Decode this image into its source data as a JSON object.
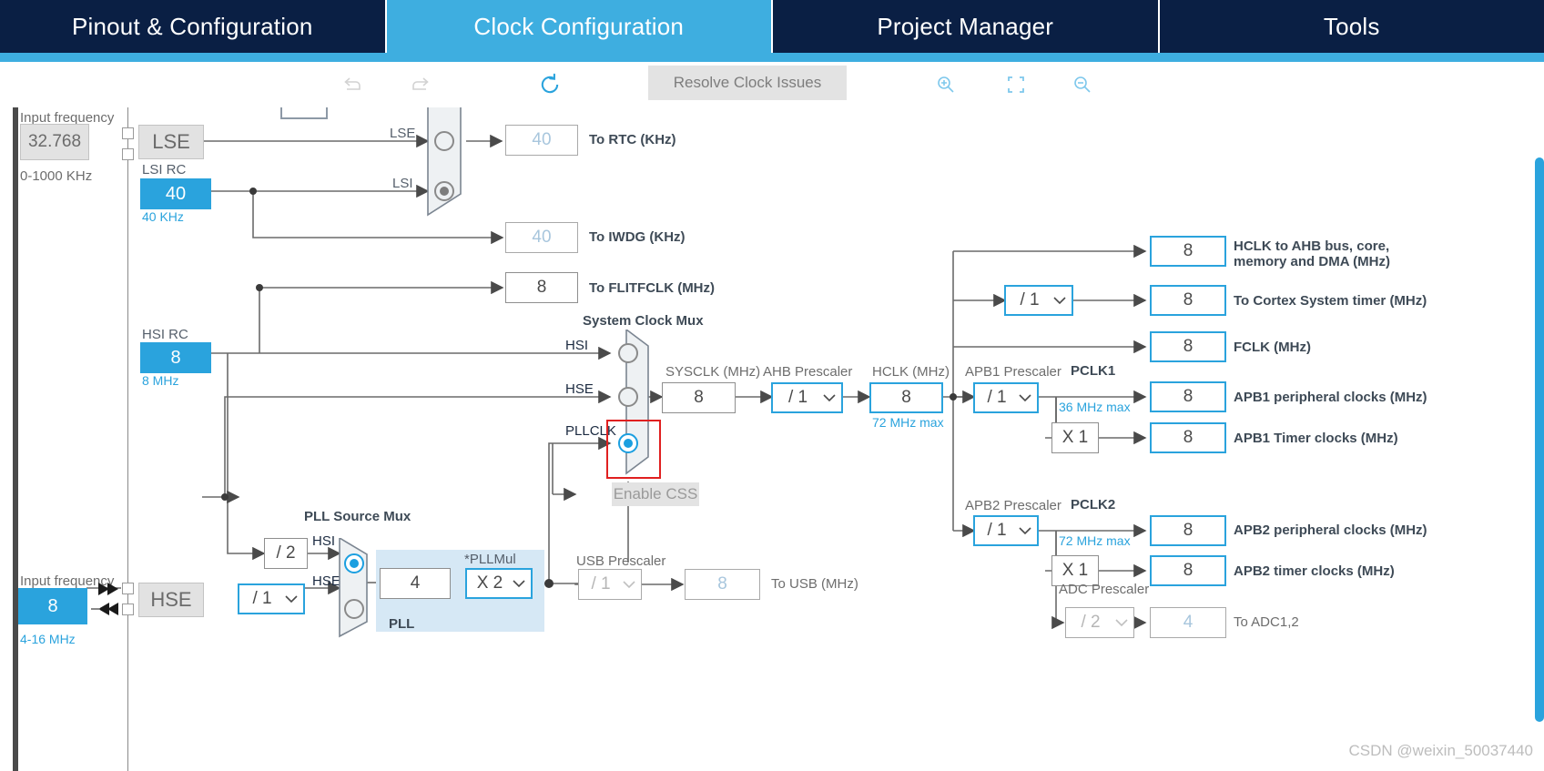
{
  "tabs": [
    {
      "label": "Pinout & Configuration",
      "active": false
    },
    {
      "label": "Clock Configuration",
      "active": true
    },
    {
      "label": "Project Manager",
      "active": false
    },
    {
      "label": "Tools",
      "active": false
    }
  ],
  "toolbar": {
    "undo_icon": "undo-arrow-icon",
    "redo_icon": "redo-arrow-icon",
    "reset_icon": "refresh-circular-arrow-icon",
    "resolve_label": "Resolve Clock Issues",
    "zoom_in_icon": "magnifier-plus-icon",
    "fit_icon": "fit-to-screen-icon",
    "zoom_out_icon": "magnifier-minus-icon"
  },
  "lse_section": {
    "input_frequency_label": "Input frequency",
    "input_frequency_value": "32.768",
    "input_frequency_range": "0-1000 KHz",
    "osc_label": "LSE",
    "lsi_rc_label": "LSI RC",
    "lsi_value": "40",
    "lsi_unit": "40 KHz",
    "mux_in_lse": "LSE",
    "mux_in_lsi": "LSI",
    "rtc_value": "40",
    "rtc_label": "To RTC (KHz)",
    "iwdg_value": "40",
    "iwdg_label": "To IWDG (KHz)"
  },
  "hsi_section": {
    "hsi_rc_label": "HSI RC",
    "hsi_value": "8",
    "hsi_unit": "8 MHz",
    "flitfclk_value": "8",
    "flitfclk_label": "To FLITFCLK (MHz)"
  },
  "hse_section": {
    "input_frequency_label": "Input frequency",
    "input_frequency_value": "8",
    "input_frequency_range": "4-16 MHz",
    "osc_label": "HSE",
    "hse_div_value": "/ 1"
  },
  "sysclk_mux": {
    "title": "System Clock Mux",
    "inputs": [
      "HSI",
      "HSE",
      "PLLCLK"
    ],
    "selected": "PLLCLK",
    "css_label": "Enable CSS"
  },
  "pll": {
    "source_mux_title": "PLL Source Mux",
    "hsi_div_value": "/ 2",
    "input_hsi": "HSI",
    "input_hse": "HSE",
    "selected": "HSI",
    "panel_label": "PLL",
    "pll_input_value": "4",
    "pllmul_label": "*PLLMul",
    "pllmul_value": "X 2"
  },
  "usb": {
    "prescaler_label": "USB Prescaler",
    "prescaler_value": "/ 1",
    "out_value": "8",
    "out_label": "To USB (MHz)"
  },
  "sysclk": {
    "label": "SYSCLK (MHz)",
    "value": "8"
  },
  "ahb": {
    "prescaler_label": "AHB Prescaler",
    "prescaler_value": "/ 1"
  },
  "hclk": {
    "label": "HCLK (MHz)",
    "value": "8",
    "max": "72 MHz max"
  },
  "outputs": [
    {
      "name": "hclk-ahb",
      "value": "8",
      "label": "HCLK to AHB bus, core,\nmemory and DMA (MHz)"
    },
    {
      "name": "cortex-systimer",
      "value": "8",
      "label": "To Cortex System timer (MHz)"
    },
    {
      "name": "fclk",
      "value": "8",
      "label": "FCLK (MHz)"
    },
    {
      "name": "apb1-peripheral",
      "value": "8",
      "label": "APB1 peripheral clocks (MHz)"
    },
    {
      "name": "apb1-timer",
      "value": "8",
      "label": "APB1 Timer clocks (MHz)"
    },
    {
      "name": "apb2-peripheral",
      "value": "8",
      "label": "APB2 peripheral clocks (MHz)"
    },
    {
      "name": "apb2-timer",
      "value": "8",
      "label": "APB2 timer clocks (MHz)"
    },
    {
      "name": "adc",
      "value": "4",
      "label": "To ADC1,2"
    }
  ],
  "cortex_prescaler": {
    "value": "/ 1"
  },
  "apb1": {
    "prescaler_label": "APB1 Prescaler",
    "prescaler_value": "/ 1",
    "pclk_label": "PCLK1",
    "max": "36 MHz max",
    "timer_mul": "X 1"
  },
  "apb2": {
    "prescaler_label": "APB2 Prescaler",
    "prescaler_value": "/ 1",
    "pclk_label": "PCLK2",
    "max": "72 MHz max",
    "timer_mul": "X 1"
  },
  "adc": {
    "prescaler_label": "ADC Prescaler",
    "prescaler_value": "/ 2"
  },
  "watermark": "CSDN @weixin_50037440",
  "colors": {
    "tab_bar": "#0a1f44",
    "accent": "#2aa3dd",
    "active_tab": "#3eaee0",
    "selected_box": "#e02020"
  }
}
